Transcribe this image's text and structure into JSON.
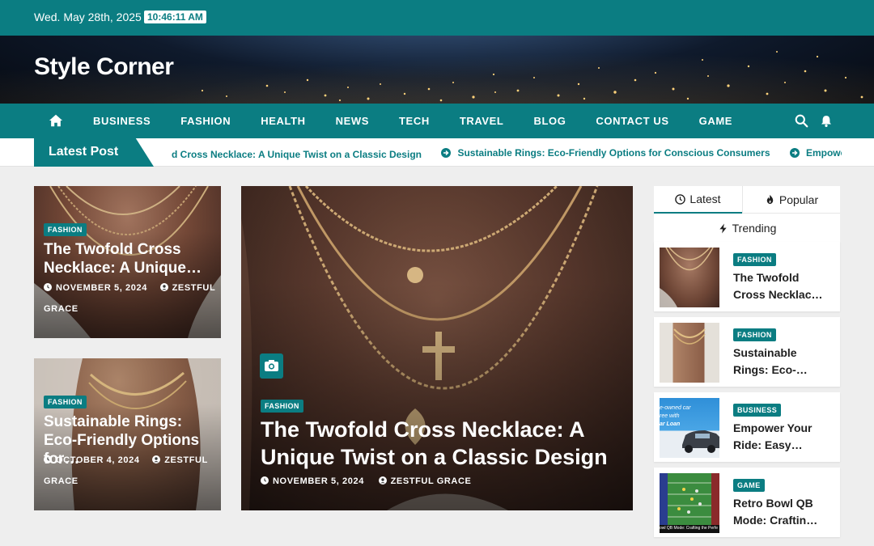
{
  "topbar": {
    "date": "Wed. May 28th, 2025",
    "time": "10:46:11 AM"
  },
  "site": {
    "title": "Style Corner"
  },
  "nav": {
    "home_icon": "home-icon",
    "items": [
      "BUSINESS",
      "FASHION",
      "HEALTH",
      "NEWS",
      "TECH",
      "TRAVEL",
      "BLOG",
      "CONTACT US",
      "GAME"
    ],
    "search_icon": "search-icon",
    "bell_icon": "bell-icon"
  },
  "ticker": {
    "label": "Latest Post",
    "items": [
      "d Cross Necklace: A Unique Twist on a Classic Design",
      "Sustainable Rings: Eco-Friendly Options for Conscious Consumers",
      "Empower Yo"
    ]
  },
  "cards": {
    "small1": {
      "category": "FASHION",
      "title": "The Twofold Cross Necklace: A Unique…",
      "date": "NOVEMBER 5, 2024",
      "author": "ZESTFUL GRACE"
    },
    "small2": {
      "category": "FASHION",
      "title": "Sustainable Rings: Eco-Friendly Options for…",
      "date": "OCTOBER 4, 2024",
      "author": "ZESTFUL GRACE"
    },
    "featured": {
      "category": "FASHION",
      "title": "The Twofold Cross Necklace: A Unique Twist on a Classic Design",
      "date": "NOVEMBER 5, 2024",
      "author": "ZESTFUL GRACE",
      "camera_icon": "camera-icon"
    }
  },
  "sidebar": {
    "tabs": [
      "Latest",
      "Popular",
      "Trending"
    ],
    "posts": [
      {
        "category": "FASHION",
        "title": "The Twofold Cross Necklac…"
      },
      {
        "category": "FASHION",
        "title": "Sustainable Rings: Eco-…"
      },
      {
        "category": "BUSINESS",
        "title": "Empower Your Ride: Easy…",
        "thumb_text": [
          "e-owned car",
          "ree with",
          "ar Loan"
        ]
      },
      {
        "category": "GAME",
        "title": "Retro Bowl QB Mode: Craftin…",
        "thumb_text": [
          "owl QB Mode: Crafting the Perfe"
        ]
      }
    ]
  },
  "colors": {
    "accent": "#0b7d82",
    "background": "#eeeeee",
    "text": "#212121"
  }
}
